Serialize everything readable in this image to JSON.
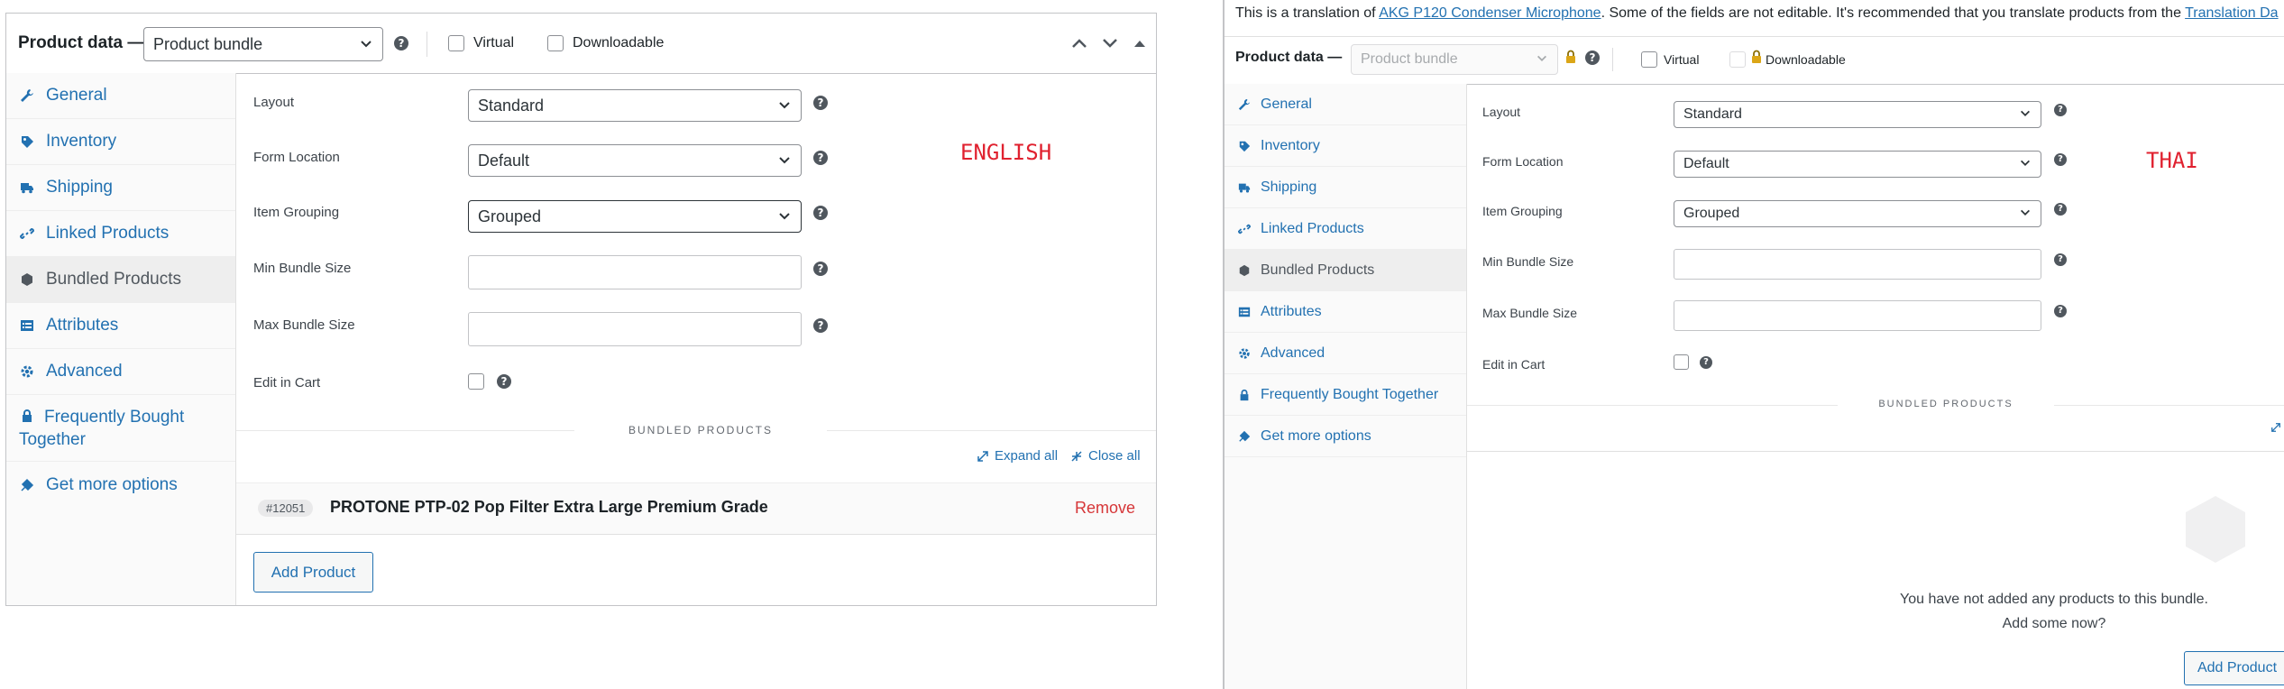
{
  "left": {
    "header": {
      "label": "Product data —",
      "product_type": "Product bundle",
      "virtual_label": "Virtual",
      "downloadable_label": "Downloadable"
    },
    "sidebar": {
      "items": [
        {
          "label": "General"
        },
        {
          "label": "Inventory"
        },
        {
          "label": "Shipping"
        },
        {
          "label": "Linked Products"
        },
        {
          "label": "Bundled Products"
        },
        {
          "label": "Attributes"
        },
        {
          "label": "Advanced"
        },
        {
          "label": "Frequently Bought Together"
        },
        {
          "label": "Get more options"
        }
      ]
    },
    "fields": {
      "layout_label": "Layout",
      "layout_value": "Standard",
      "form_location_label": "Form Location",
      "form_location_value": "Default",
      "item_grouping_label": "Item Grouping",
      "item_grouping_value": "Grouped",
      "min_bundle_label": "Min Bundle Size",
      "max_bundle_label": "Max Bundle Size",
      "edit_in_cart_label": "Edit in Cart"
    },
    "annotation": "ENGLISH",
    "bundled_section": {
      "title": "BUNDLED PRODUCTS",
      "expand_all": "Expand all",
      "close_all": "Close all",
      "item_id": "#12051",
      "item_name": "PROTONE PTP-02 Pop Filter Extra Large Premium Grade",
      "remove": "Remove",
      "add_product": "Add Product"
    }
  },
  "right": {
    "notice": {
      "prefix": "This is a translation of ",
      "product_link": "AKG P120 Condenser Microphone",
      "middle": ". Some of the fields are not editable. It's recommended that you translate products from the ",
      "tail_link": "Translation Da"
    },
    "header": {
      "label": "Product data —",
      "product_type": "Product bundle",
      "virtual_label": "Virtual",
      "downloadable_label": "Downloadable"
    },
    "sidebar": {
      "items": [
        {
          "label": "General"
        },
        {
          "label": "Inventory"
        },
        {
          "label": "Shipping"
        },
        {
          "label": "Linked Products"
        },
        {
          "label": "Bundled Products"
        },
        {
          "label": "Attributes"
        },
        {
          "label": "Advanced"
        },
        {
          "label": "Frequently Bought Together"
        },
        {
          "label": "Get more options"
        }
      ]
    },
    "fields": {
      "layout_label": "Layout",
      "layout_value": "Standard",
      "form_location_label": "Form Location",
      "form_location_value": "Default",
      "item_grouping_label": "Item Grouping",
      "item_grouping_value": "Grouped",
      "min_bundle_label": "Min Bundle Size",
      "max_bundle_label": "Max Bundle Size",
      "edit_in_cart_label": "Edit in Cart"
    },
    "annotation": "THAI",
    "bundled_section": {
      "title": "BUNDLED PRODUCTS",
      "empty_line1": "You have not added any products to this bundle.",
      "empty_line2": "Add some now?",
      "add_product": "Add Product"
    }
  },
  "colors": {
    "link": "#2271b1",
    "remove": "#d63638",
    "annotation": "#e0212f"
  }
}
